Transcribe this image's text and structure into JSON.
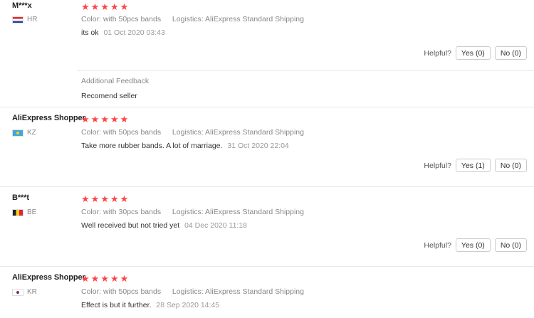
{
  "reviews": [
    {
      "user": "M***x",
      "country": "HR",
      "color_label": "Color:",
      "color_value": "with 50pcs bands",
      "logistics_label": "Logistics:",
      "logistics_value": "AliExpress Standard Shipping",
      "text": "its ok",
      "date": "01 Oct 2020 03:43",
      "helpful_label": "Helpful?",
      "yes_label": "Yes (0)",
      "no_label": "No (0)",
      "stars": 5,
      "additional": {
        "title": "Additional Feedback",
        "text": "Recomend seller"
      }
    },
    {
      "user": "AliExpress Shopper",
      "country": "KZ",
      "color_label": "Color:",
      "color_value": "with 50pcs bands",
      "logistics_label": "Logistics:",
      "logistics_value": "AliExpress Standard Shipping",
      "text": "Take more rubber bands. A lot of marriage.",
      "date": "31 Oct 2020 22:04",
      "helpful_label": "Helpful?",
      "yes_label": "Yes (1)",
      "no_label": "No (0)",
      "stars": 5
    },
    {
      "user": "B***t",
      "country": "BE",
      "color_label": "Color:",
      "color_value": "with 30pcs bands",
      "logistics_label": "Logistics:",
      "logistics_value": "AliExpress Standard Shipping",
      "text": "Well received but not tried yet",
      "date": "04 Dec 2020 11:18",
      "helpful_label": "Helpful?",
      "yes_label": "Yes (0)",
      "no_label": "No (0)",
      "stars": 5
    },
    {
      "user": "AliExpress Shopper",
      "country": "KR",
      "color_label": "Color:",
      "color_value": "with 50pcs bands",
      "logistics_label": "Logistics:",
      "logistics_value": "AliExpress Standard Shipping",
      "text": "Effect is but it further.",
      "date": "28 Sep 2020 14:45",
      "stars": 5
    }
  ],
  "colors": {
    "star": "#ff4747",
    "separator": "#e8e8e8"
  }
}
